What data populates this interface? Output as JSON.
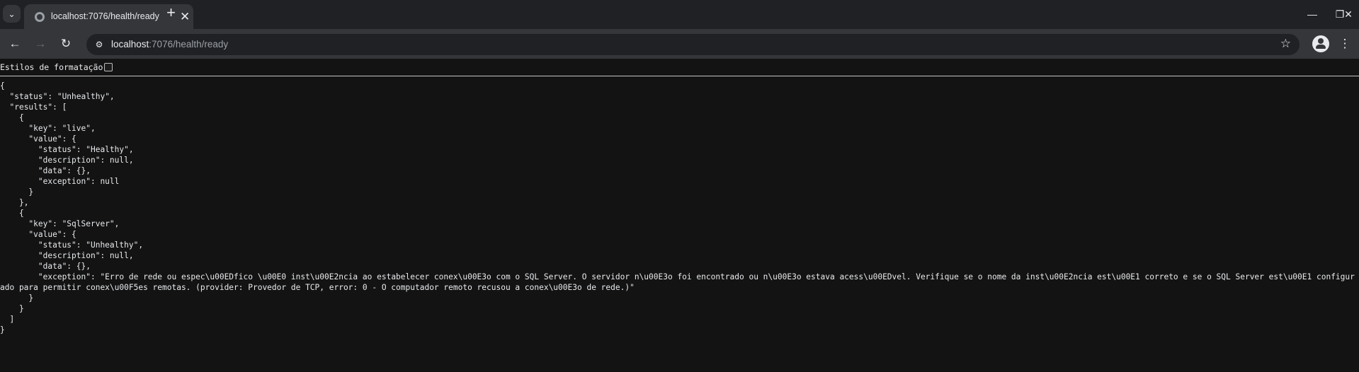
{
  "browser": {
    "tab_title": "localhost:7076/health/ready",
    "url_host": "localhost",
    "url_rest": ":7076/health/ready",
    "new_tab_glyph": "+",
    "tab_close_glyph": "✕",
    "tab_search_glyph": "⌄"
  },
  "toolbar": {
    "back_glyph": "←",
    "forward_glyph": "→",
    "reload_glyph": "↻",
    "star_glyph": "☆",
    "menu_glyph": "⋮",
    "site_info_glyph": "⚙"
  },
  "window": {
    "minimize_glyph": "—",
    "maximize_glyph": "❐",
    "close_glyph": "✕"
  },
  "pretty_print": {
    "label": "Estilos de formatação",
    "checked": false
  },
  "json_lines": [
    "{",
    "  \"status\": \"Unhealthy\",",
    "  \"results\": [",
    "    {",
    "      \"key\": \"live\",",
    "      \"value\": {",
    "        \"status\": \"Healthy\",",
    "        \"description\": null,",
    "        \"data\": {},",
    "        \"exception\": null",
    "      }",
    "    },",
    "    {",
    "      \"key\": \"SqlServer\",",
    "      \"value\": {",
    "        \"status\": \"Unhealthy\",",
    "        \"description\": null,",
    "        \"data\": {},",
    "        \"exception\": \"Erro de rede ou espec\\u00EDfico \\u00E0 inst\\u00E2ncia ao estabelecer conex\\u00E3o com o SQL Server. O servidor n\\u00E3o foi encontrado ou n\\u00E3o estava acess\\u00EDvel. Verifique se o nome da inst\\u00E2ncia est\\u00E1 correto e se o SQL Server est\\u00E1 configurado para permitir conex\\u00F5es remotas. (provider: Provedor de TCP, error: 0 - O computador remoto recusou a conex\\u00E3o de rede.)\"",
    "      }",
    "    }",
    "  ]",
    "}"
  ]
}
